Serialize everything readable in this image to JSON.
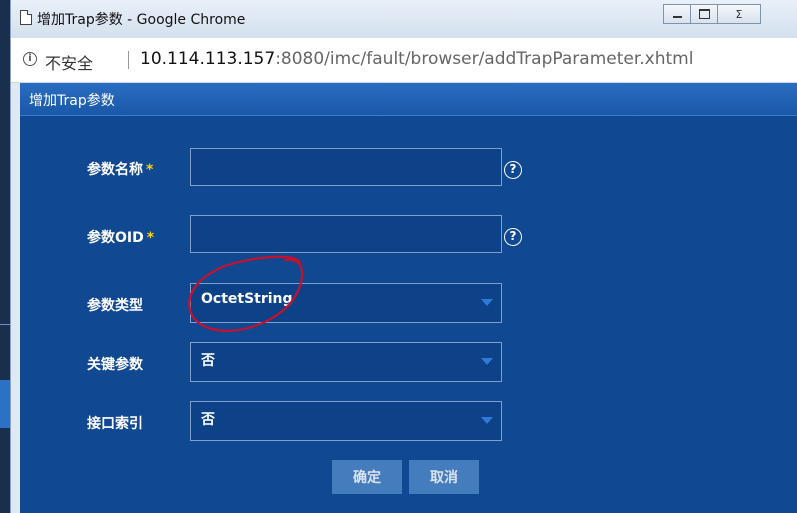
{
  "window": {
    "title": "增加Trap参数 - Google Chrome",
    "minimize_label": "",
    "restore_label": "",
    "close_label": "Σ"
  },
  "address_bar": {
    "security_label": "不安全",
    "url_host": "10.114.113.157",
    "url_rest": ":8080/imc/fault/browser/addTrapParameter.xhtml"
  },
  "dialog": {
    "title": "增加Trap参数",
    "fields": {
      "param_name": {
        "label": "参数名称",
        "required_mark": "*",
        "value": "",
        "help": "?"
      },
      "param_oid": {
        "label": "参数OID",
        "required_mark": "*",
        "value": "",
        "help": "?"
      },
      "param_type": {
        "label": "参数类型",
        "value": "OctetString"
      },
      "key_param": {
        "label": "关键参数",
        "value": "否"
      },
      "interface_index": {
        "label": "接口索引",
        "value": "否"
      }
    },
    "buttons": {
      "ok": "确定",
      "cancel": "取消"
    }
  },
  "colors": {
    "dialog_bg": "#104891",
    "header_bg": "#1a58a8",
    "required": "#ffd200",
    "annotation": "#c8102e"
  }
}
